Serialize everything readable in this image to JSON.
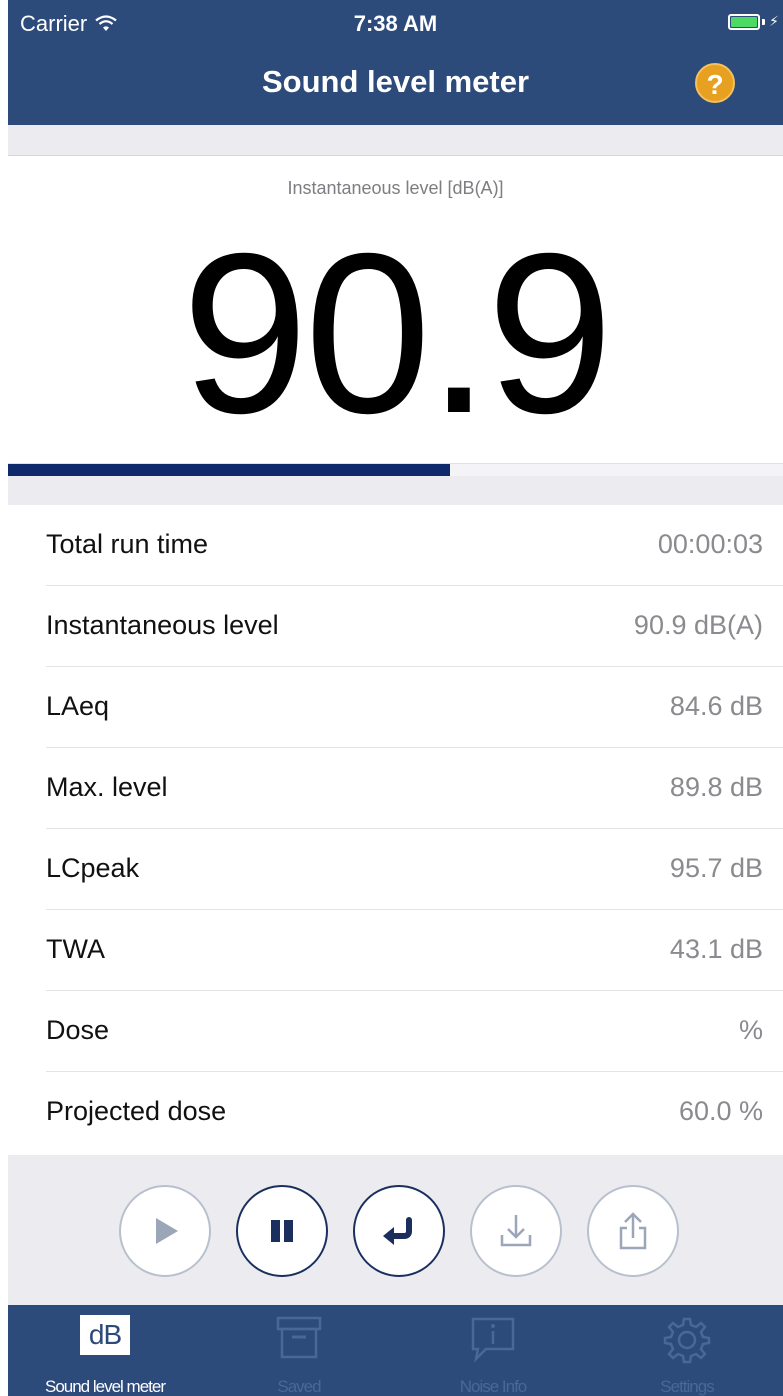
{
  "status_bar": {
    "carrier": "Carrier",
    "time": "7:38 AM"
  },
  "header": {
    "title": "Sound level meter",
    "help_label": "?"
  },
  "level": {
    "caption": "Instantaneous level [dB(A)]",
    "value": "90.9",
    "bar_fraction": 0.57
  },
  "stats": [
    {
      "label": "Total run time",
      "value": "00:00:03"
    },
    {
      "label": "Instantaneous level",
      "value": "90.9 dB(A)"
    },
    {
      "label": "LAeq",
      "value": "84.6 dB"
    },
    {
      "label": "Max. level",
      "value": "89.8 dB"
    },
    {
      "label": "LCpeak",
      "value": "95.7 dB"
    },
    {
      "label": "TWA",
      "value": "43.1 dB"
    },
    {
      "label": "Dose",
      "value": "%"
    },
    {
      "label": "Projected dose",
      "value": "60.0 %"
    }
  ],
  "controls": [
    {
      "icon": "play-icon",
      "enabled": false
    },
    {
      "icon": "pause-icon",
      "enabled": true
    },
    {
      "icon": "reset-icon",
      "enabled": true
    },
    {
      "icon": "download-icon",
      "enabled": false
    },
    {
      "icon": "share-icon",
      "enabled": false
    }
  ],
  "tabs": [
    {
      "label": "Sound level meter",
      "icon_text": "dB",
      "icon": "db-icon",
      "selected": true
    },
    {
      "label": "Saved",
      "icon": "archive-box-icon",
      "selected": false
    },
    {
      "label": "Noise Info",
      "icon": "info-bubble-icon",
      "selected": false
    },
    {
      "label": "Settings",
      "icon": "gear-icon",
      "selected": false
    }
  ],
  "colors": {
    "nav_bar": "#2c4a7a",
    "level_bar": "#0f2a6a",
    "help_badge": "#e8a020",
    "battery": "#4cd964"
  }
}
